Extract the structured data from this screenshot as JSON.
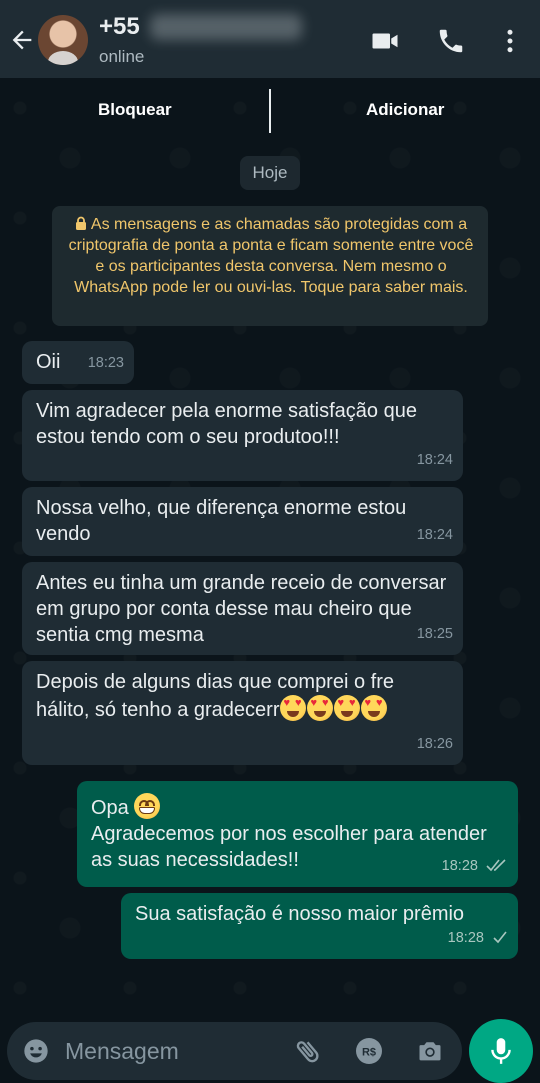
{
  "header": {
    "contact_name": "+55",
    "status": "online"
  },
  "actions": {
    "block_label": "Bloquear",
    "add_label": "Adicionar"
  },
  "chat": {
    "date_label": "Hoje",
    "encryption_notice": "As mensagens e as chamadas são protegidas com a criptografia de ponta a ponta e ficam somente entre você e os participantes desta conversa. Nem mesmo o WhatsApp pode ler ou ouvi-las. Toque para saber mais.",
    "messages": [
      {
        "direction": "in",
        "text": "Oii",
        "time": "18:23"
      },
      {
        "direction": "in",
        "text": "Vim agradecer pela enorme satisfação que estou tendo com o seu produtoo!!!",
        "time": "18:24"
      },
      {
        "direction": "in",
        "text": "Nossa velho, que diferença enorme estou vendo",
        "time": "18:24"
      },
      {
        "direction": "in",
        "text": "Antes eu tinha um grande receio de conversar em grupo por conta desse mau cheiro que sentia cmg mesma",
        "time": "18:25"
      },
      {
        "direction": "in",
        "text": "Depois de alguns dias que comprei o fre hálito, só tenho a gradecerr",
        "emoji": "smiling-face-with-heart-eyes x4",
        "time": "18:26"
      },
      {
        "direction": "out",
        "text_line1": "Opa",
        "emoji": "grinning-face",
        "text": "Agradecemos por nos escolher para atender as suas necessidades!!",
        "time": "18:28",
        "status": "delivered"
      },
      {
        "direction": "out",
        "text": "Sua satisfação é nosso maior prêmio",
        "time": "18:28",
        "status": "sent"
      }
    ]
  },
  "composer": {
    "placeholder": "Mensagem"
  },
  "colors": {
    "header_bg": "#1f2c34",
    "chat_bg": "#0b141a",
    "incoming_bubble": "#1f2c34",
    "outgoing_bubble": "#005c4b",
    "accent": "#00a884",
    "encryption_text": "#f0c66b"
  }
}
